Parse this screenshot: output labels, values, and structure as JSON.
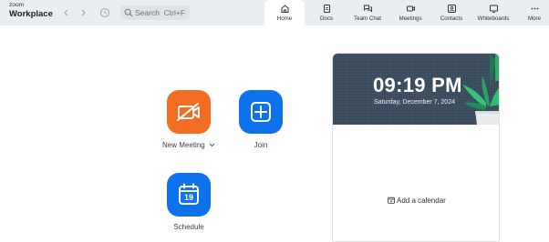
{
  "app": {
    "brand_small": "zoom",
    "brand_big": "Workplace"
  },
  "search": {
    "placeholder": "Search",
    "shortcut": "Ctrl+F"
  },
  "tabs": [
    {
      "label": "Home",
      "icon": "home-icon",
      "active": true
    },
    {
      "label": "Docs",
      "icon": "docs-icon"
    },
    {
      "label": "Team Chat",
      "icon": "chat-icon"
    },
    {
      "label": "Meetings",
      "icon": "video-icon"
    },
    {
      "label": "Contacts",
      "icon": "contacts-icon"
    },
    {
      "label": "Whiteboards",
      "icon": "whiteboard-icon"
    },
    {
      "label": "More",
      "icon": "more-icon"
    }
  ],
  "actions": {
    "new_meeting": {
      "label": "New Meeting",
      "color": "#f26d21",
      "icon": "video-off-icon"
    },
    "join": {
      "label": "Join",
      "color": "#0e72ed",
      "icon": "plus-icon"
    },
    "schedule": {
      "label": "Schedule",
      "color": "#0e72ed",
      "icon": "calendar-icon",
      "day": "19"
    }
  },
  "clock": {
    "time": "09:19 PM",
    "date": "Saturday, December 7, 2024"
  },
  "calendar": {
    "add_label": "Add a calendar"
  }
}
